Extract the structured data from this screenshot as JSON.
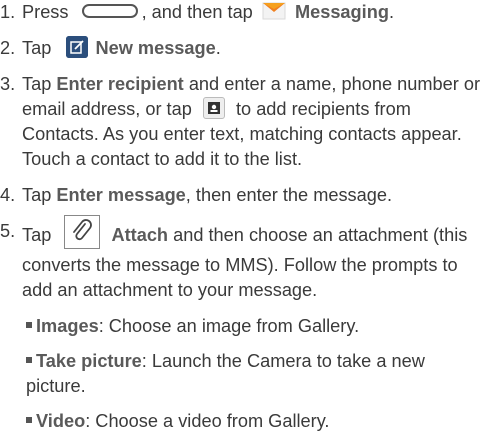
{
  "steps": [
    {
      "num": "1.",
      "pre": "Press",
      "mid": ", and then tap",
      "bold": "Messaging",
      "post": "."
    },
    {
      "num": "2.",
      "pre": "Tap",
      "bold": "New message",
      "post": "."
    },
    {
      "num": "3.",
      "pre": "Tap",
      "bold": "Enter recipient",
      "post": "and enter a name, phone number or email address, or tap",
      "post2": "to add recipients from Contacts. As you enter text, matching contacts appear. Touch a contact to add it to the list."
    },
    {
      "num": "4.",
      "pre": "Tap",
      "bold": "Enter message",
      "post": ", then enter the message."
    },
    {
      "num": "5.",
      "pre": "Tap",
      "bold": "Attach",
      "post": "and then choose an attachment (this converts the message to MMS). Follow the prompts to add an attachment to your message."
    }
  ],
  "bullets": [
    {
      "label": "Images",
      "text": ": Choose an image from Gallery."
    },
    {
      "label": "Take picture",
      "text": ": Launch the Camera to take a new picture."
    },
    {
      "label": "Video",
      "text": ": Choose a video from Gallery."
    }
  ],
  "icons": {
    "home_key": "home-key-icon",
    "messaging": "messaging-envelope-icon",
    "new_message": "new-message-icon",
    "contacts": "contacts-icon",
    "attach": "paperclip-icon"
  }
}
